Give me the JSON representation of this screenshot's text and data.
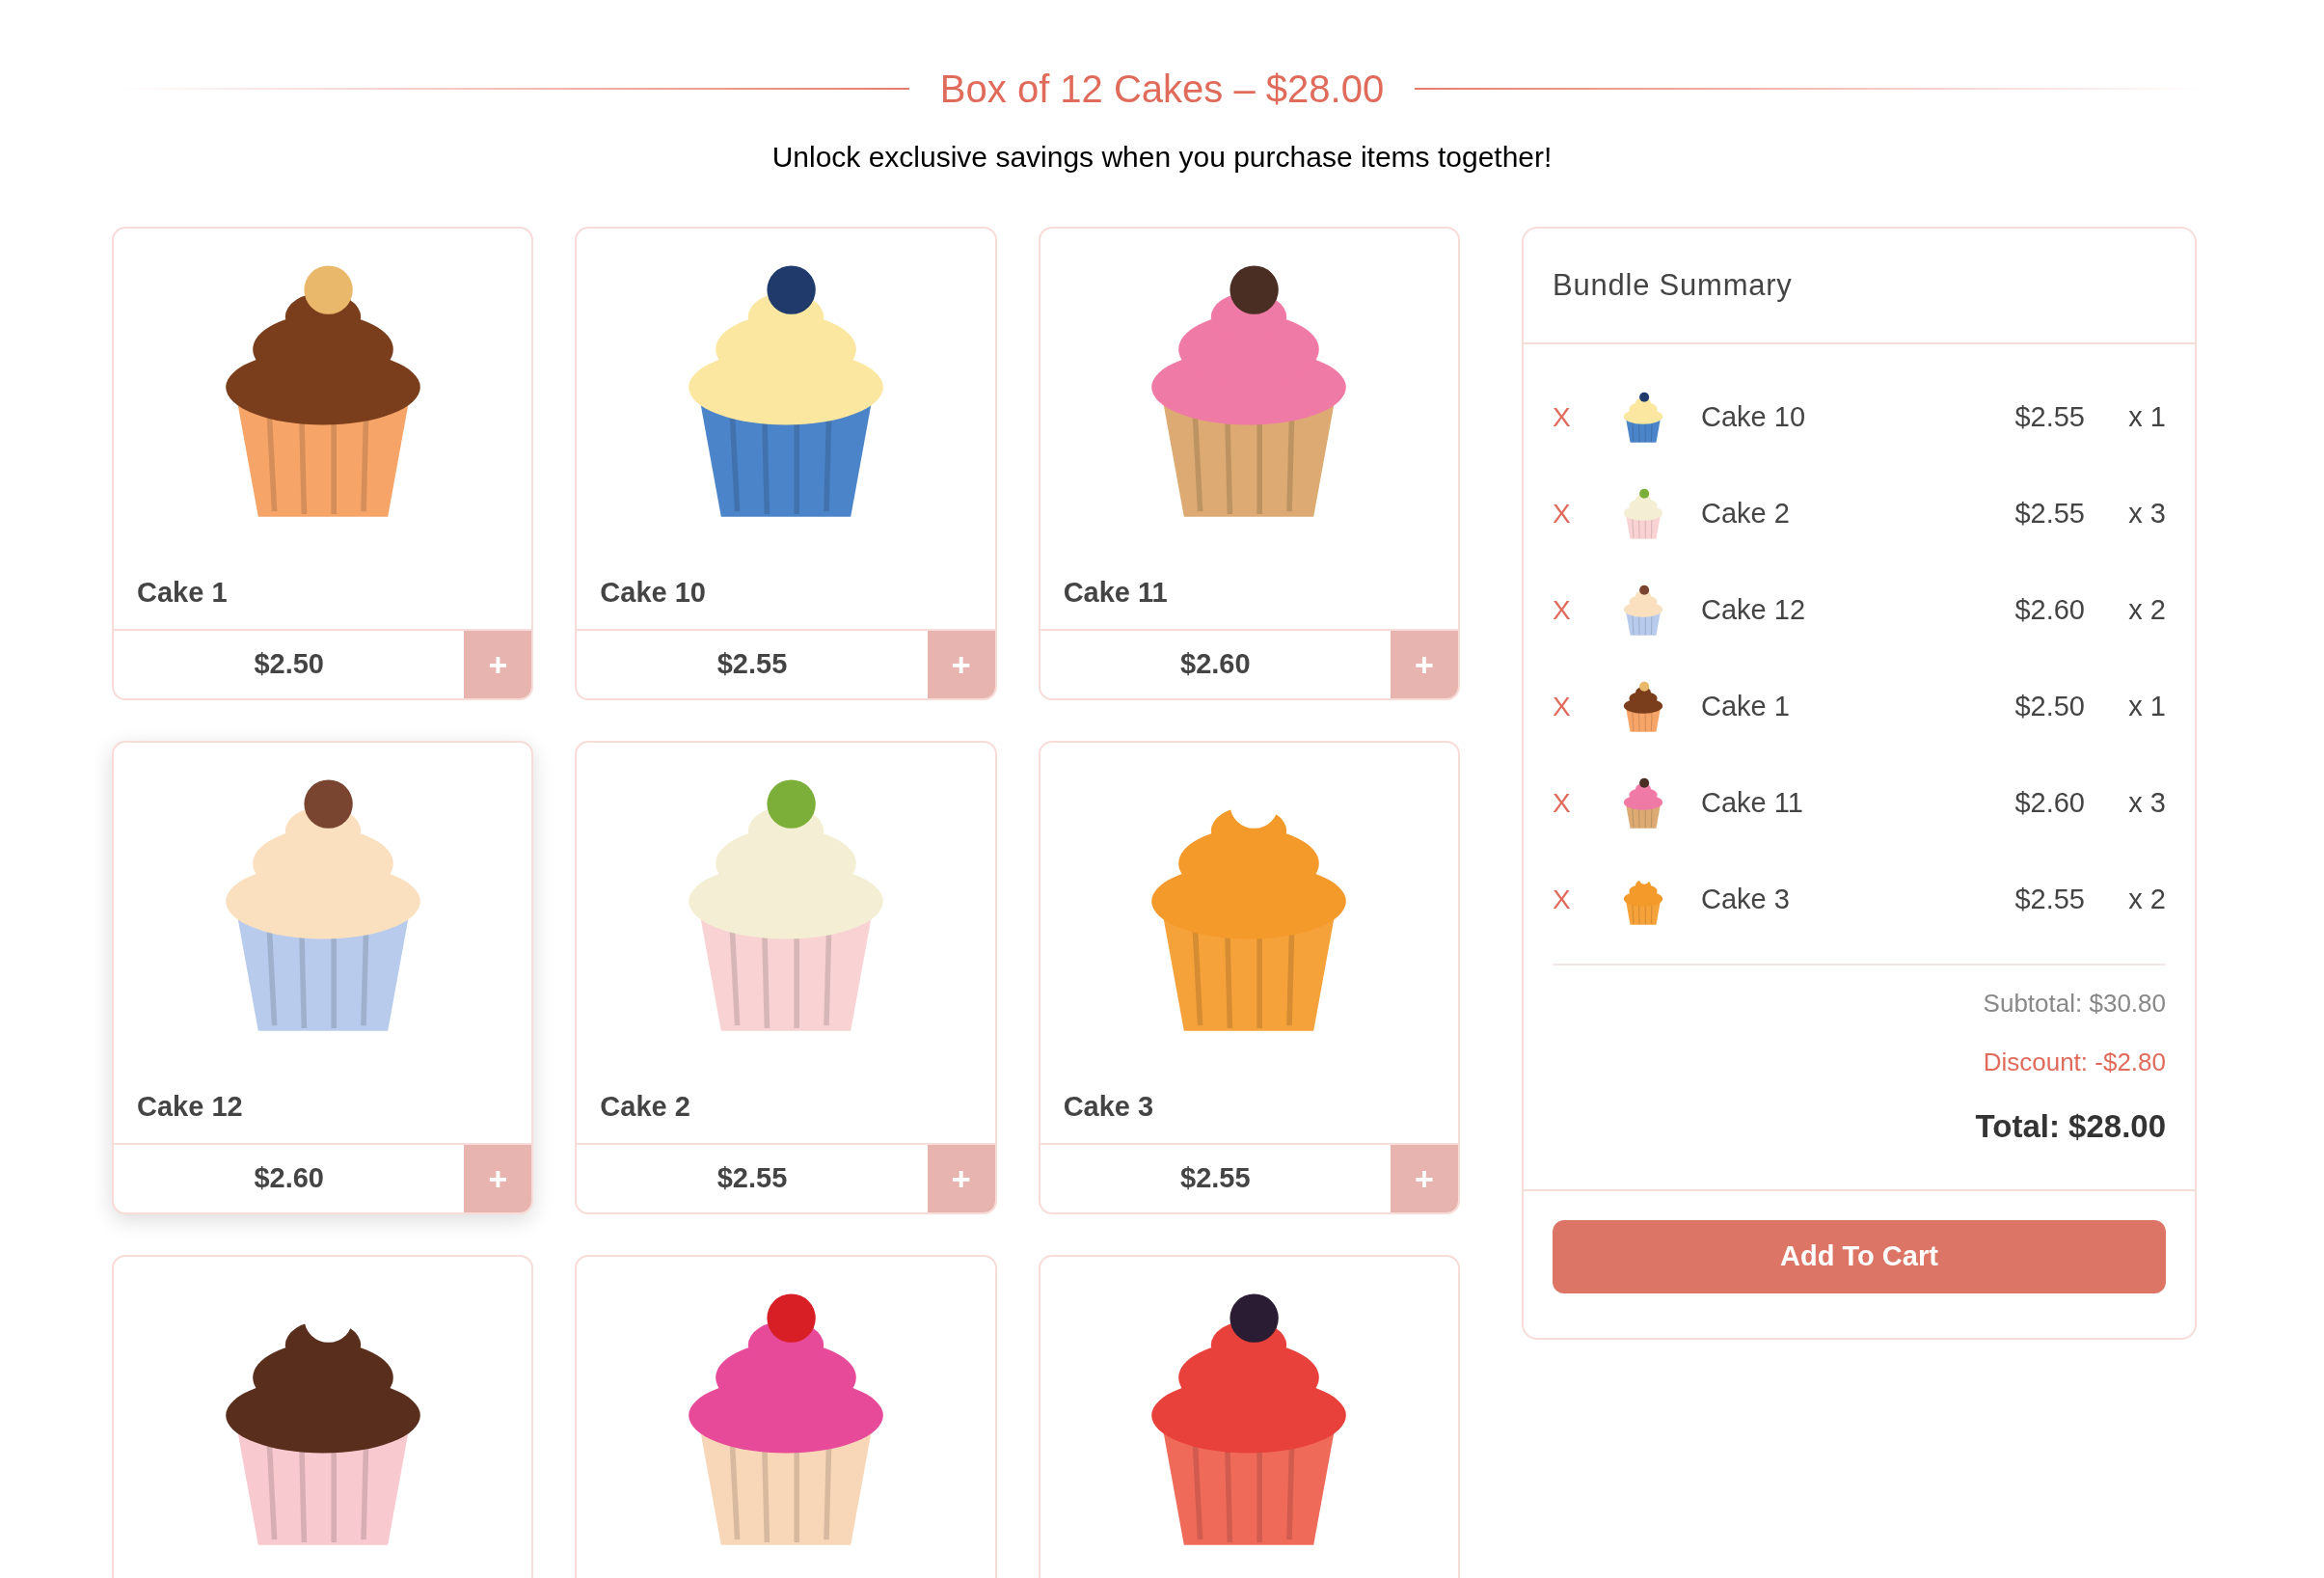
{
  "header": {
    "title": "Box of 12 Cakes – $28.00",
    "subtitle": "Unlock exclusive savings when you purchase items together!"
  },
  "products": [
    {
      "name": "Cake 1",
      "price": "$2.50",
      "button": "+",
      "hovered": false
    },
    {
      "name": "Cake 10",
      "price": "$2.55",
      "button": "+",
      "hovered": false
    },
    {
      "name": "Cake 11",
      "price": "$2.60",
      "button": "+",
      "hovered": false
    },
    {
      "name": "Cake 12",
      "price": "$2.60",
      "button": "+",
      "hovered": true
    },
    {
      "name": "Cake 2",
      "price": "$2.55",
      "button": "+",
      "hovered": false
    },
    {
      "name": "Cake 3",
      "price": "$2.55",
      "button": "+",
      "hovered": false
    },
    {
      "hovered": false
    },
    {
      "hovered": false
    },
    {
      "hovered": false
    }
  ],
  "summary": {
    "title": "Bundle Summary",
    "items": [
      {
        "remove": "X",
        "name": "Cake 10",
        "price": "$2.55",
        "qty": "x 1"
      },
      {
        "remove": "X",
        "name": "Cake 2",
        "price": "$2.55",
        "qty": "x 3"
      },
      {
        "remove": "X",
        "name": "Cake 12",
        "price": "$2.60",
        "qty": "x 2"
      },
      {
        "remove": "X",
        "name": "Cake 1",
        "price": "$2.50",
        "qty": "x 1"
      },
      {
        "remove": "X",
        "name": "Cake 11",
        "price": "$2.60",
        "qty": "x 3"
      },
      {
        "remove": "X",
        "name": "Cake 3",
        "price": "$2.55",
        "qty": "x 2"
      }
    ],
    "subtotal": "Subtotal: $30.80",
    "discount": "Discount: -$2.80",
    "total": "Total: $28.00",
    "button": "Add To Cart"
  }
}
